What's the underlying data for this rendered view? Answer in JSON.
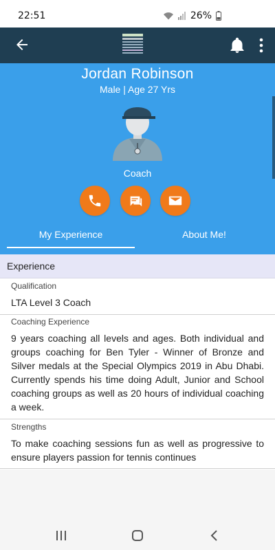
{
  "status_bar": {
    "time": "22:51",
    "battery": "26%",
    "icons": [
      "wifi-icon",
      "signal-icon",
      "battery-icon"
    ]
  },
  "app_bar": {
    "logo_text": "winchester RACQUETS & FITNESS",
    "icons": [
      "back-arrow-icon",
      "bell-icon",
      "more-vertical-icon"
    ]
  },
  "profile": {
    "name": "Jordan Robinson",
    "meta": "Male | Age 27 Yrs",
    "role": "Coach",
    "actions": [
      "phone-icon",
      "chat-icon",
      "mail-icon"
    ]
  },
  "tabs": [
    {
      "label": "My Experience",
      "selected": true
    },
    {
      "label": "About Me!",
      "selected": false
    }
  ],
  "experience": {
    "header": "Experience",
    "items": [
      {
        "label": "Qualification",
        "value": "LTA Level 3 Coach"
      },
      {
        "label": "Coaching Experience",
        "value": "9 years coaching all levels and ages. Both individual and groups coaching for Ben Tyler - Winner of Bronze and Silver medals at the Special Olympics 2019 in Abu Dhabi. Currently spends his time doing Adult, Junior and School coaching groups as well as 20 hours of individual coaching a week."
      },
      {
        "label": "Strengths",
        "value": "To make coaching sessions fun as well as progressive to ensure players passion for tennis continues"
      }
    ]
  },
  "colors": {
    "app_bar": "#1f3e52",
    "profile_bg": "#3a9fea",
    "action_button": "#f07a1a",
    "section_header_bg": "#e6e6f7"
  },
  "nav_bar": {
    "icons": [
      "recent-apps-icon",
      "home-icon",
      "back-icon"
    ]
  }
}
